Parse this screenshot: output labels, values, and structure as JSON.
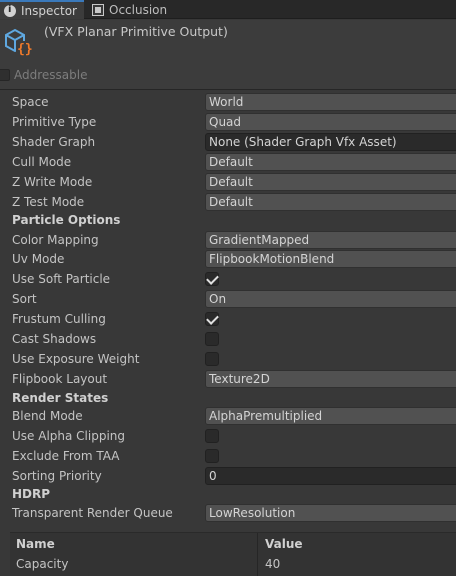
{
  "tabs": [
    {
      "label": "Inspector",
      "icon": "info-icon",
      "active": true
    },
    {
      "label": "Occlusion",
      "icon": "occlusion-icon",
      "active": false
    }
  ],
  "component": {
    "title": "(VFX Planar Primitive Output)",
    "icon": "vfx-output-icon",
    "addressable_label": "Addressable",
    "addressable_checked": false
  },
  "properties": [
    {
      "label": "Space",
      "type": "dropdown",
      "value": "World"
    },
    {
      "label": "Primitive Type",
      "type": "dropdown",
      "value": "Quad"
    },
    {
      "label": "Shader Graph",
      "type": "object",
      "value": "None (Shader Graph Vfx Asset)"
    },
    {
      "label": "Cull Mode",
      "type": "dropdown",
      "value": "Default"
    },
    {
      "label": "Z Write Mode",
      "type": "dropdown",
      "value": "Default"
    },
    {
      "label": "Z Test Mode",
      "type": "dropdown",
      "value": "Default"
    },
    {
      "label": "Particle Options",
      "type": "section"
    },
    {
      "label": "Color Mapping",
      "type": "dropdown",
      "value": "GradientMapped"
    },
    {
      "label": "Uv Mode",
      "type": "dropdown",
      "value": "FlipbookMotionBlend"
    },
    {
      "label": "Use Soft Particle",
      "type": "checkbox",
      "checked": true
    },
    {
      "label": "Sort",
      "type": "dropdown",
      "value": "On"
    },
    {
      "label": "Frustum Culling",
      "type": "checkbox",
      "checked": true
    },
    {
      "label": "Cast Shadows",
      "type": "checkbox",
      "checked": false
    },
    {
      "label": "Use Exposure Weight",
      "type": "checkbox",
      "checked": false
    },
    {
      "label": "Flipbook Layout",
      "type": "dropdown",
      "value": "Texture2D"
    },
    {
      "label": "Render States",
      "type": "section"
    },
    {
      "label": "Blend Mode",
      "type": "dropdown",
      "value": "AlphaPremultiplied"
    },
    {
      "label": "Use Alpha Clipping",
      "type": "checkbox",
      "checked": false
    },
    {
      "label": "Exclude From TAA",
      "type": "checkbox",
      "checked": false
    },
    {
      "label": "Sorting Priority",
      "type": "number",
      "value": "0"
    },
    {
      "label": "HDRP",
      "type": "section"
    },
    {
      "label": "Transparent Render Queue",
      "type": "dropdown",
      "value": "LowResolution"
    }
  ],
  "table": {
    "headers": [
      "Name",
      "Value"
    ],
    "rows": [
      [
        "Capacity",
        "40"
      ]
    ]
  }
}
